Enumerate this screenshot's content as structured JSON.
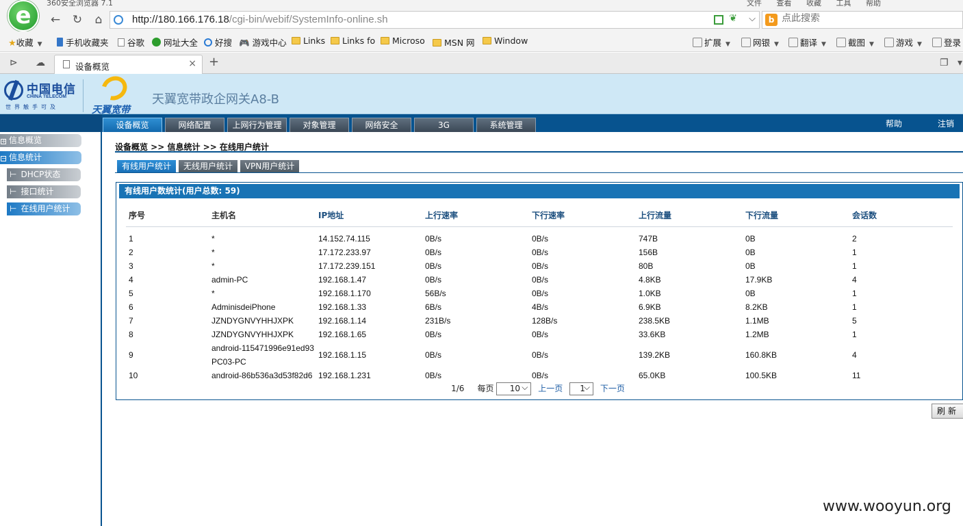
{
  "browser": {
    "title_text": "360安全浏览器 7.1",
    "title_menus": "文件  查看  收藏  工具  帮助",
    "url_host": "http://180.166.176.18",
    "url_path": "/cgi-bin/webif/SystemInfo-online.sh",
    "search_placeholder": "点此搜索",
    "favorites": [
      "收藏",
      "手机收藏夹",
      "谷歌",
      "网址大全",
      "好搜",
      "游戏中心",
      "Links",
      "Links fo",
      "Microso",
      "MSN 网",
      "Window"
    ],
    "right_tools": [
      "扩展",
      "网银",
      "翻译",
      "截图",
      "游戏",
      "登录"
    ],
    "tab_title": "设备概览",
    "tab_close": "×",
    "new_tab": "+"
  },
  "header": {
    "brand_cn": "中国电信",
    "brand_en": "CHINA TELECOM",
    "brand_slogan": "世界触手可及",
    "sub_brand": "天翼宽带",
    "product_name": "天翼宽带政企网关A8-B"
  },
  "nav": {
    "tabs": [
      "设备概览",
      "网络配置",
      "上网行为管理",
      "对象管理",
      "网络安全",
      "3G",
      "系统管理"
    ],
    "help": "帮助",
    "logout": "注销"
  },
  "sidebar": {
    "items": [
      "信息概览",
      "信息统计",
      "DHCP状态",
      "接口统计",
      "在线用户统计"
    ]
  },
  "breadcrumb": "设备概览 >> 信息统计 >> 在线用户统计",
  "subtabs": [
    "有线用户统计",
    "无线用户统计",
    "VPN用户统计"
  ],
  "panel_title": "有线用户数统计(用户总数: 59)",
  "table": {
    "headers": [
      "序号",
      "主机名",
      "IP地址",
      "上行速率",
      "下行速率",
      "上行流量",
      "下行流量",
      "会话数"
    ],
    "rows": [
      [
        "1",
        "*",
        "14.152.74.115",
        "0B/s",
        "0B/s",
        "747B",
        "0B",
        "2"
      ],
      [
        "2",
        "*",
        "17.172.233.97",
        "0B/s",
        "0B/s",
        "156B",
        "0B",
        "1"
      ],
      [
        "3",
        "*",
        "17.172.239.151",
        "0B/s",
        "0B/s",
        "80B",
        "0B",
        "1"
      ],
      [
        "4",
        "admin-PC",
        "192.168.1.47",
        "0B/s",
        "0B/s",
        "4.8KB",
        "17.9KB",
        "4"
      ],
      [
        "5",
        "*",
        "192.168.1.170",
        "56B/s",
        "0B/s",
        "1.0KB",
        "0B",
        "1"
      ],
      [
        "6",
        "AdminisdeiPhone",
        "192.168.1.33",
        "6B/s",
        "4B/s",
        "6.9KB",
        "8.2KB",
        "1"
      ],
      [
        "7",
        "JZNDYGNVYHHJXPK",
        "192.168.1.14",
        "231B/s",
        "128B/s",
        "238.5KB",
        "1.1MB",
        "5"
      ],
      [
        "8",
        "JZNDYGNVYHHJXPK",
        "192.168.1.65",
        "0B/s",
        "0B/s",
        "33.6KB",
        "1.2MB",
        "1"
      ],
      [
        "9",
        "android-115471996e91ed93 PC03-PC",
        "192.168.1.15",
        "0B/s",
        "0B/s",
        "139.2KB",
        "160.8KB",
        "4"
      ],
      [
        "10",
        "android-86b536a3d53f82d6",
        "192.168.1.231",
        "0B/s",
        "0B/s",
        "65.0KB",
        "100.5KB",
        "11"
      ]
    ]
  },
  "pager": {
    "page_info": "1/6",
    "per_page_label": "每页",
    "per_page_value": "10",
    "prev": "上一页",
    "page_select": "1",
    "next": "下一页"
  },
  "refresh_label": "刷新",
  "watermark": "www.wooyun.org"
}
